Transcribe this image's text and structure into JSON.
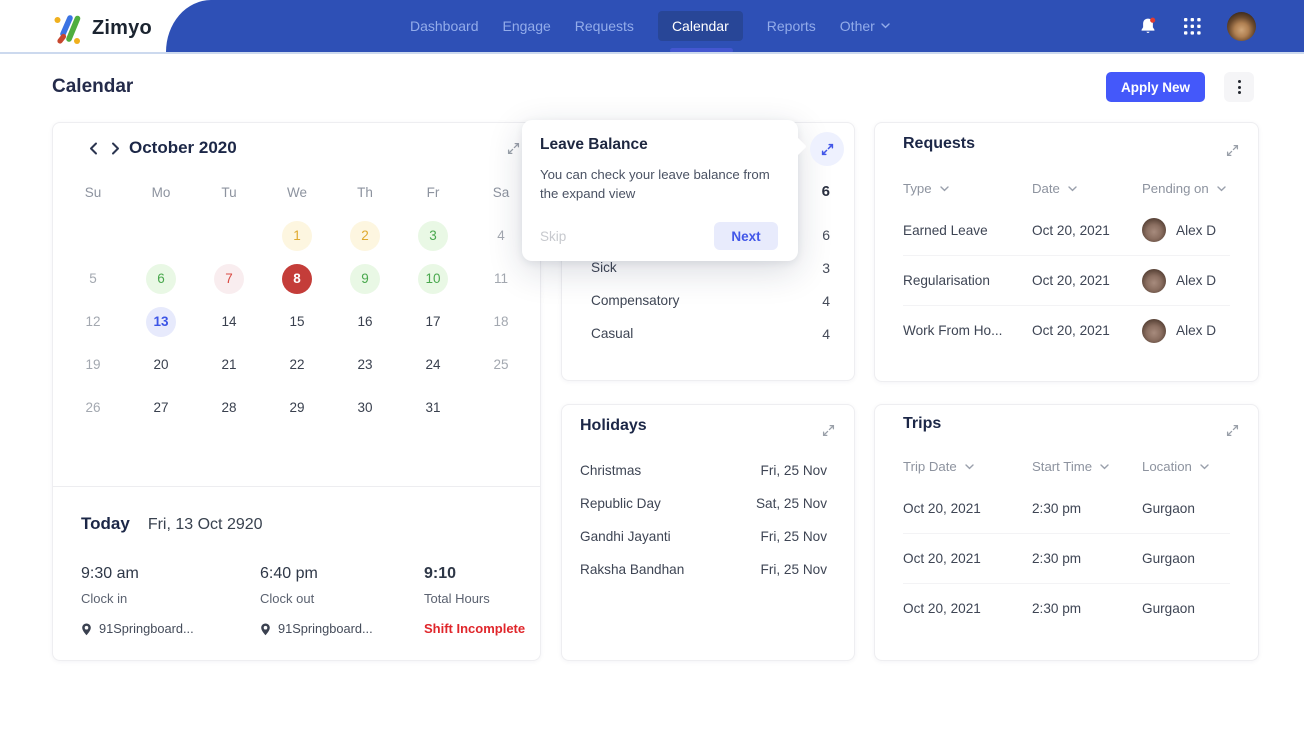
{
  "brand": {
    "name": "Zimyo"
  },
  "nav": {
    "items": [
      {
        "label": "Dashboard",
        "active": false,
        "dropdown": false
      },
      {
        "label": "Engage",
        "active": false,
        "dropdown": false
      },
      {
        "label": "Requests",
        "active": false,
        "dropdown": false
      },
      {
        "label": "Calendar",
        "active": true,
        "dropdown": false
      },
      {
        "label": "Reports",
        "active": false,
        "dropdown": false
      },
      {
        "label": "Other",
        "active": false,
        "dropdown": true
      }
    ]
  },
  "page": {
    "title": "Calendar",
    "apply_button": "Apply New"
  },
  "calendar_card": {
    "month_label": "October 2020",
    "day_headers": [
      "Su",
      "Mo",
      "Tu",
      "We",
      "Th",
      "Fr",
      "Sa"
    ],
    "cells": [
      {
        "d": "",
        "s": "empty"
      },
      {
        "d": "",
        "s": "empty"
      },
      {
        "d": "",
        "s": "empty"
      },
      {
        "d": "1",
        "s": "yellow"
      },
      {
        "d": "2",
        "s": "yellow"
      },
      {
        "d": "3",
        "s": "green"
      },
      {
        "d": "4",
        "s": "muted"
      },
      {
        "d": "5",
        "s": "muted"
      },
      {
        "d": "6",
        "s": "green"
      },
      {
        "d": "7",
        "s": "pink"
      },
      {
        "d": "8",
        "s": "red"
      },
      {
        "d": "9",
        "s": "green"
      },
      {
        "d": "10",
        "s": "green"
      },
      {
        "d": "11",
        "s": "muted"
      },
      {
        "d": "12",
        "s": "muted"
      },
      {
        "d": "13",
        "s": "blue"
      },
      {
        "d": "14",
        "s": ""
      },
      {
        "d": "15",
        "s": ""
      },
      {
        "d": "16",
        "s": ""
      },
      {
        "d": "17",
        "s": ""
      },
      {
        "d": "18",
        "s": "muted"
      },
      {
        "d": "19",
        "s": "muted"
      },
      {
        "d": "20",
        "s": ""
      },
      {
        "d": "21",
        "s": ""
      },
      {
        "d": "22",
        "s": ""
      },
      {
        "d": "23",
        "s": ""
      },
      {
        "d": "24",
        "s": ""
      },
      {
        "d": "25",
        "s": "muted"
      },
      {
        "d": "26",
        "s": "muted"
      },
      {
        "d": "27",
        "s": ""
      },
      {
        "d": "28",
        "s": ""
      },
      {
        "d": "29",
        "s": ""
      },
      {
        "d": "30",
        "s": ""
      },
      {
        "d": "31",
        "s": ""
      },
      {
        "d": "",
        "s": "empty"
      }
    ],
    "today": {
      "label": "Today",
      "date": "Fri, 13 Oct 2920",
      "clock_in": {
        "time": "9:30 am",
        "label": "Clock in",
        "location": "91Springboard..."
      },
      "clock_out": {
        "time": "6:40 pm",
        "label": "Clock out",
        "location": "91Springboard..."
      },
      "total": {
        "time": "9:10",
        "label": "Total Hours",
        "status": "Shift Incomplete"
      }
    }
  },
  "leave_balance_card": {
    "rows": [
      {
        "label": "",
        "value": "6"
      },
      {
        "label": "",
        "value": "6"
      },
      {
        "label": "Sick",
        "value": "3"
      },
      {
        "label": "Compensatory",
        "value": "4"
      },
      {
        "label": "Casual",
        "value": "4"
      }
    ]
  },
  "popup": {
    "title": "Leave Balance",
    "body": "You can check your leave balance from the expand view",
    "skip": "Skip",
    "next": "Next"
  },
  "requests_card": {
    "title": "Requests",
    "columns": [
      "Type",
      "Date",
      "Pending on"
    ],
    "rows": [
      {
        "type": "Earned Leave",
        "date": "Oct 20, 2021",
        "pending_on": "Alex D"
      },
      {
        "type": "Regularisation",
        "date": "Oct 20, 2021",
        "pending_on": "Alex D"
      },
      {
        "type": "Work From Ho...",
        "date": "Oct 20, 2021",
        "pending_on": "Alex D"
      }
    ]
  },
  "holidays_card": {
    "title": "Holidays",
    "rows": [
      {
        "name": "Christmas",
        "date": "Fri, 25 Nov"
      },
      {
        "name": "Republic Day",
        "date": "Sat, 25 Nov"
      },
      {
        "name": "Gandhi Jayanti",
        "date": "Fri, 25 Nov"
      },
      {
        "name": "Raksha Bandhan",
        "date": "Fri, 25 Nov"
      }
    ]
  },
  "trips_card": {
    "title": "Trips",
    "columns": [
      "Trip Date",
      "Start Time",
      "Location"
    ],
    "rows": [
      {
        "date": "Oct 20, 2021",
        "time": "2:30 pm",
        "location": "Gurgaon"
      },
      {
        "date": "Oct 20, 2021",
        "time": "2:30 pm",
        "location": "Gurgaon"
      },
      {
        "date": "Oct 20, 2021",
        "time": "2:30 pm",
        "location": "Gurgaon"
      }
    ]
  },
  "colors": {
    "accent": "#4458fa",
    "nav": "#2e50b6",
    "nav-active": "#284697",
    "title": "#1c2747",
    "text": "#3e4554",
    "muted": "#8d939f",
    "red": "#e0262b"
  }
}
